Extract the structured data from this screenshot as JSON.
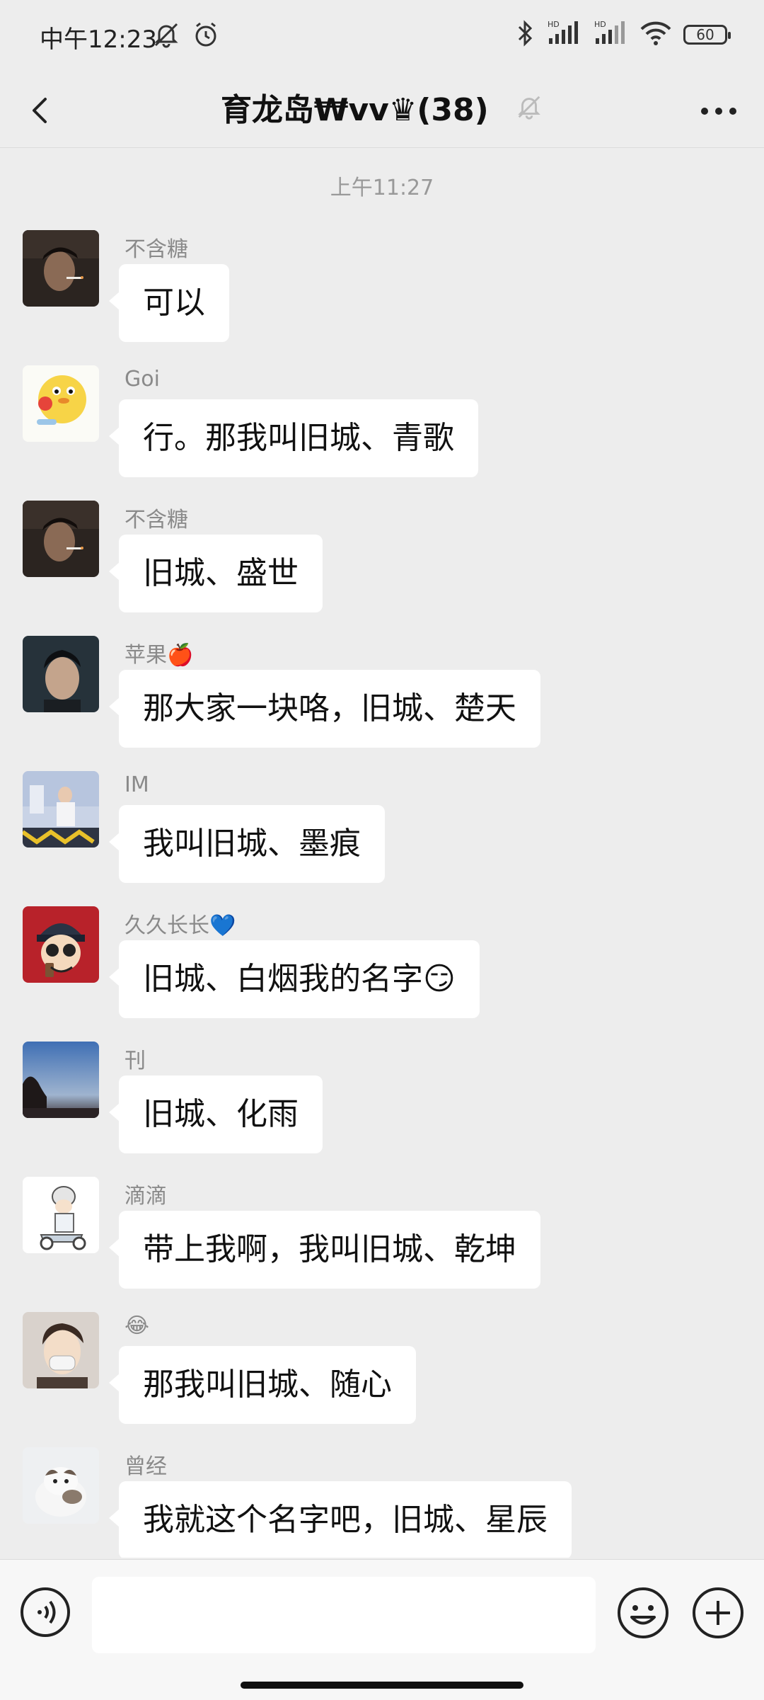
{
  "status_bar": {
    "time": "中午12:23",
    "battery": "60",
    "icons": [
      "mute-bell-icon",
      "alarm-icon",
      "bluetooth-icon",
      "signal-hd-icon",
      "signal-hd-icon",
      "wifi-icon",
      "battery-icon"
    ]
  },
  "header": {
    "title": "育龙岛₩vv♛(38)",
    "back_icon": "chevron-left-icon",
    "mute_icon": "mute-bell-icon",
    "more_icon": "more-dots-icon"
  },
  "chat": {
    "time_separator": "上午11:27",
    "messages": [
      {
        "sender": "不含糖",
        "text": "可以"
      },
      {
        "sender": "Goi",
        "text": "行。那我叫旧城、青歌"
      },
      {
        "sender": "不含糖",
        "text": "旧城、盛世"
      },
      {
        "sender": "苹果🍎",
        "text": "那大家一块咯，旧城、楚天"
      },
      {
        "sender": "IM",
        "text": "我叫旧城、墨痕"
      },
      {
        "sender": "久久长长💙",
        "text": "旧城、白烟我的名字😏"
      },
      {
        "sender": "刊",
        "text": "旧城、化雨"
      },
      {
        "sender": "滴滴",
        "text": "带上我啊，我叫旧城、乾坤"
      },
      {
        "sender": "😂",
        "text": "那我叫旧城、随心"
      },
      {
        "sender": "曾经",
        "text": "我就这个名字吧，旧城、星辰"
      }
    ]
  },
  "input_bar": {
    "voice_icon": "voice-icon",
    "input_value": "",
    "emoji_icon": "emoji-icon",
    "plus_icon": "plus-icon"
  },
  "colors": {
    "background": "#ededed",
    "bubble": "#ffffff",
    "sender_name": "#8a8a8a",
    "time_separator": "#999999"
  }
}
